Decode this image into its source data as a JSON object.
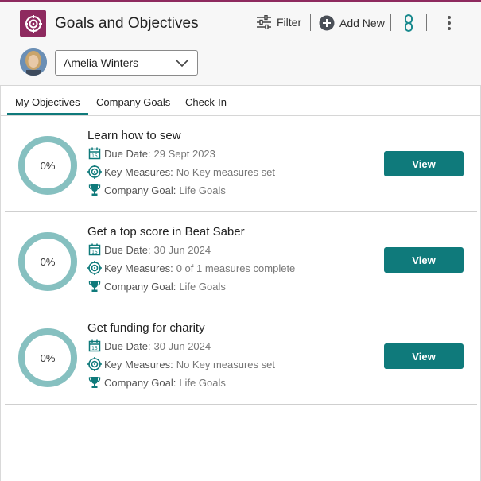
{
  "header": {
    "title": "Goals and Objectives",
    "filter_label": "Filter",
    "add_new_label": "Add New",
    "accent_color": "#8e2a5f"
  },
  "user": {
    "selected_name": "Amelia Winters"
  },
  "tabs": [
    {
      "label": "My Objectives",
      "active": true
    },
    {
      "label": "Company Goals",
      "active": false
    },
    {
      "label": "Check-In",
      "active": false
    }
  ],
  "labels": {
    "due_date": "Due Date:",
    "key_measures": "Key Measures:",
    "company_goal": "Company Goal:",
    "view_button": "View"
  },
  "objectives": [
    {
      "title": "Learn how to sew",
      "progress_label": "0%",
      "progress": 0,
      "due_date": "29 Sept 2023",
      "key_measures": "No Key measures set",
      "company_goal": "Life Goals"
    },
    {
      "title": "Get a top score in Beat Saber",
      "progress_label": "0%",
      "progress": 0,
      "due_date": "30 Jun 2024",
      "key_measures": "0 of 1 measures complete",
      "company_goal": "Life Goals"
    },
    {
      "title": "Get funding for charity",
      "progress_label": "0%",
      "progress": 0,
      "due_date": "30 Jun 2024",
      "key_measures": "No Key measures set",
      "company_goal": "Life Goals"
    }
  ],
  "colors": {
    "primary": "#0f7a7b",
    "ring": "#86c0c0"
  }
}
